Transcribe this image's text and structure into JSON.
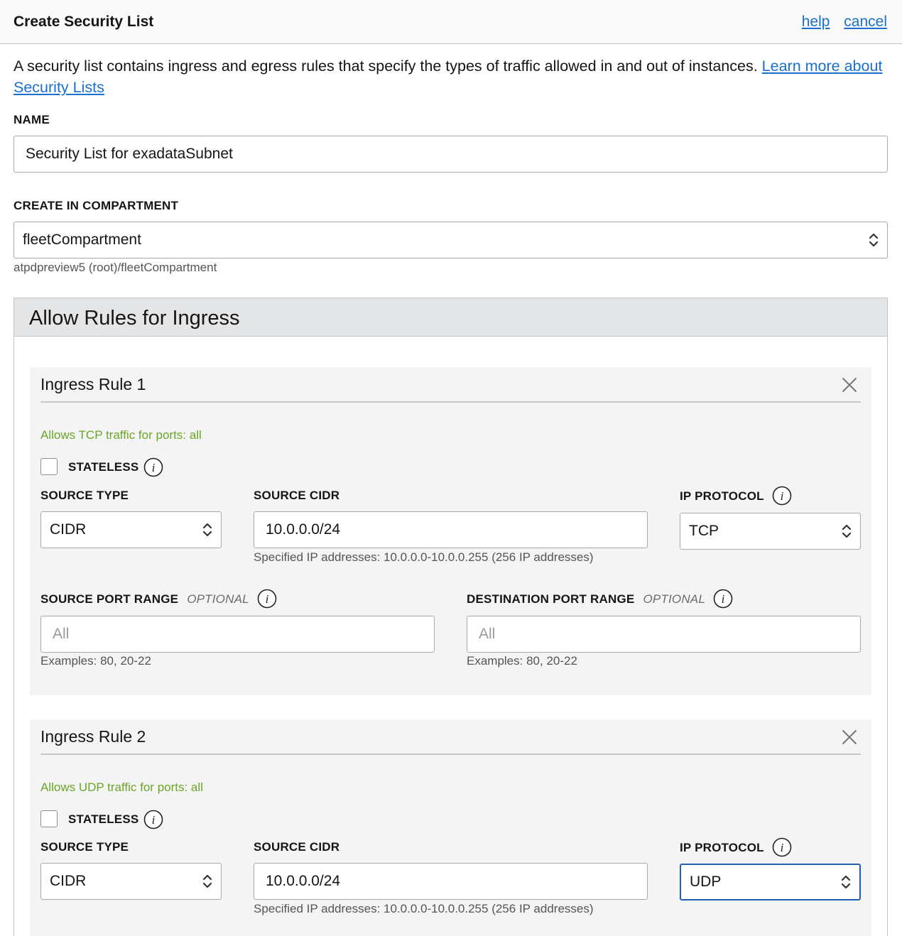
{
  "header": {
    "title": "Create Security List",
    "help": "help",
    "cancel": "cancel"
  },
  "intro": {
    "text": "A security list contains ingress and egress rules that specify the types of traffic allowed in and out of instances. ",
    "link": "Learn more about Security Lists"
  },
  "name": {
    "label": "NAME",
    "value": "Security List for exadataSubnet"
  },
  "compartment": {
    "label": "CREATE IN COMPARTMENT",
    "value": "fleetCompartment",
    "path": "atpdpreview5 (root)/fleetCompartment"
  },
  "ingress": {
    "title": "Allow Rules for Ingress",
    "rules": [
      {
        "title": "Ingress Rule 1",
        "summary": "Allows TCP traffic for ports: all",
        "stateless_label": "STATELESS",
        "source_type_label": "SOURCE TYPE",
        "source_type": "CIDR",
        "source_cidr_label": "SOURCE CIDR",
        "source_cidr": "10.0.0.0/24",
        "cidr_hint": "Specified IP addresses: 10.0.0.0-10.0.0.255 (256 IP addresses)",
        "ip_protocol_label": "IP PROTOCOL",
        "ip_protocol": "TCP",
        "source_port_label": "SOURCE PORT RANGE",
        "dest_port_label": "DESTINATION PORT RANGE",
        "optional": "OPTIONAL",
        "port_placeholder": "All",
        "port_hint": "Examples: 80, 20-22"
      },
      {
        "title": "Ingress Rule 2",
        "summary": "Allows UDP traffic for ports: all",
        "stateless_label": "STATELESS",
        "source_type_label": "SOURCE TYPE",
        "source_type": "CIDR",
        "source_cidr_label": "SOURCE CIDR",
        "source_cidr": "10.0.0.0/24",
        "cidr_hint": "Specified IP addresses: 10.0.0.0-10.0.0.255 (256 IP addresses)",
        "ip_protocol_label": "IP PROTOCOL",
        "ip_protocol": "UDP"
      }
    ]
  },
  "colors": {
    "link": "#1a6fd0",
    "success_text": "#6aa628",
    "focus_border": "#1f5fb4",
    "panel_header": "#e4e5e6",
    "rule_background": "#f4f4f4"
  },
  "icons": {
    "close": "close-icon",
    "info": "info-icon",
    "select_arrows": "chevron-updown-icon"
  }
}
